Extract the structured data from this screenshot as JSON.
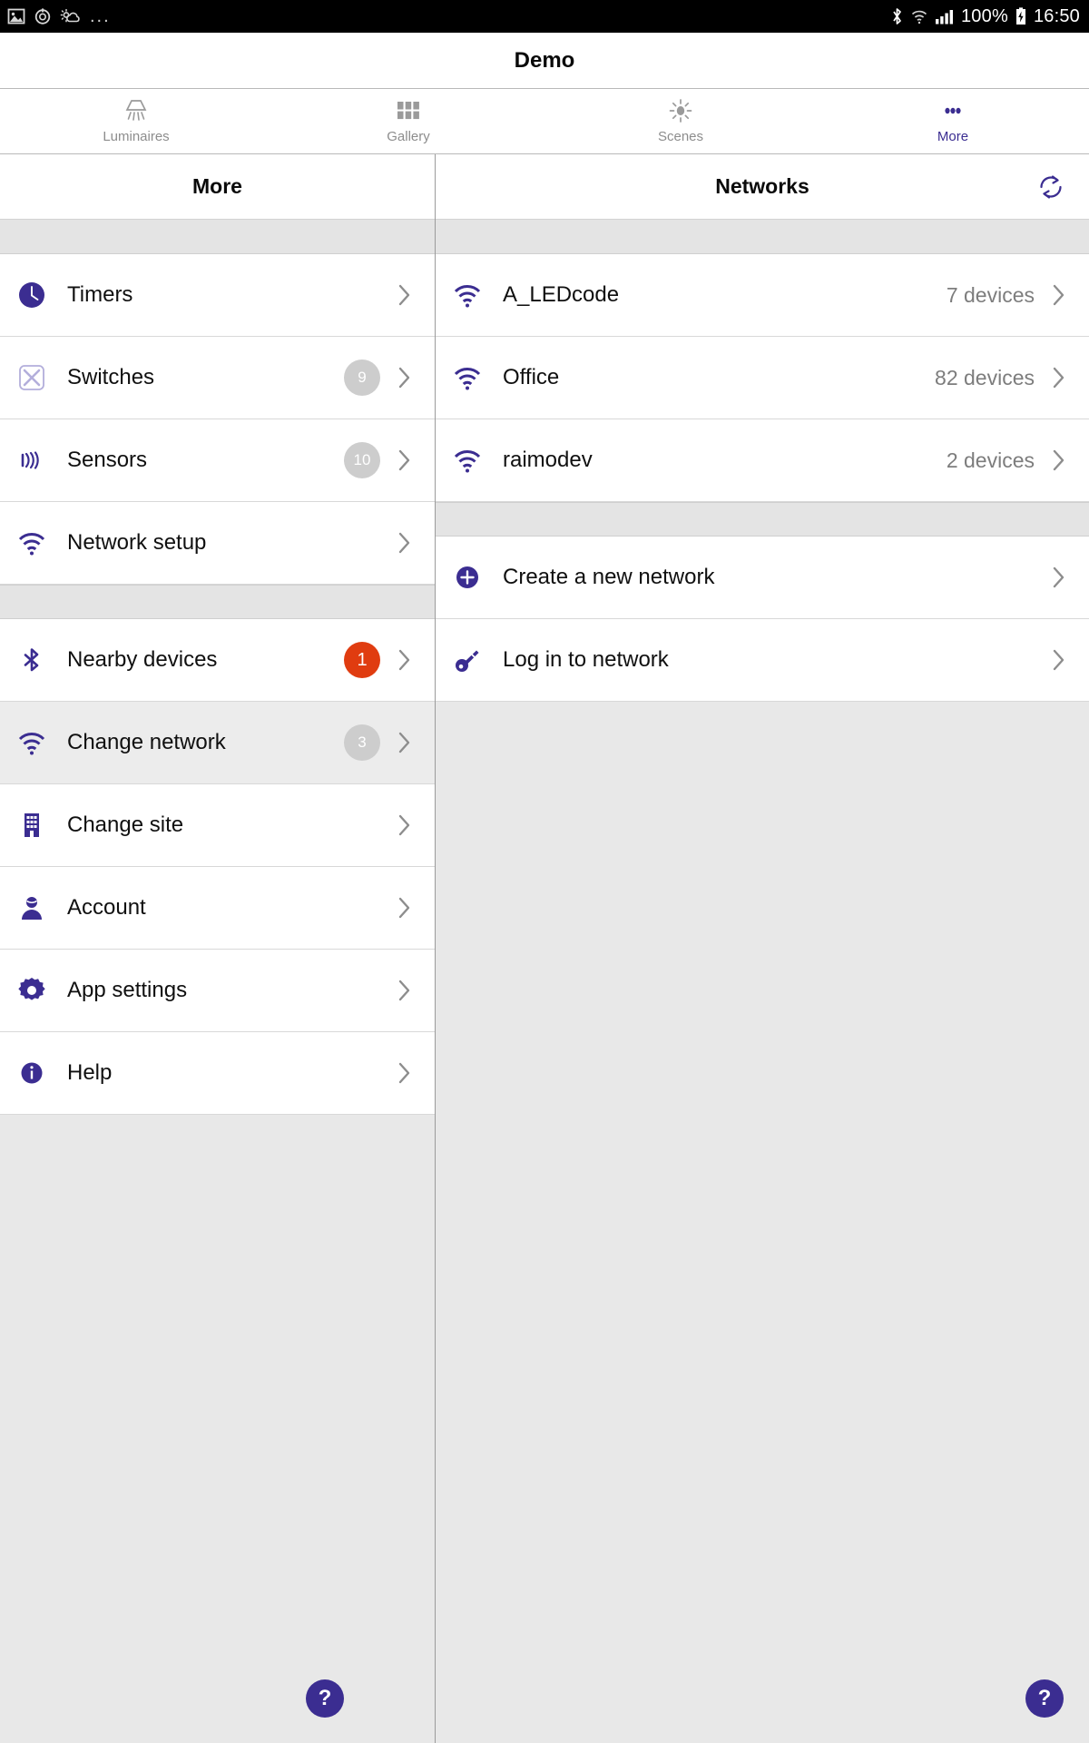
{
  "status_bar": {
    "left_icons": [
      "image-icon",
      "alarm-icon",
      "weather-icon"
    ],
    "overflow": "...",
    "bluetooth_icon": "bluetooth-icon",
    "wifi_icon": "wifi-icon",
    "signal_icon": "signal-bars-icon",
    "battery_percent": "100%",
    "battery_icon": "battery-charging-icon",
    "time": "16:50"
  },
  "app": {
    "title": "Demo",
    "accent_color": "#3b2d91",
    "alert_color": "#e03c10"
  },
  "tabs": [
    {
      "label": "Luminaires",
      "icon": "luminaire-lamp-icon",
      "active": false
    },
    {
      "label": "Gallery",
      "icon": "grid-icon",
      "active": false
    },
    {
      "label": "Scenes",
      "icon": "sun-brightness-icon",
      "active": false
    },
    {
      "label": "More",
      "icon": "more-dots-icon",
      "active": true
    }
  ],
  "left_pane": {
    "title": "More",
    "groups": [
      {
        "items": [
          {
            "label": "Timers",
            "icon": "clock-icon",
            "badge": null,
            "selected": false
          },
          {
            "label": "Switches",
            "icon": "switch-x-icon",
            "badge": "9",
            "selected": false
          },
          {
            "label": "Sensors",
            "icon": "sensor-waves-icon",
            "badge": "10",
            "selected": false
          },
          {
            "label": "Network setup",
            "icon": "wifi-icon",
            "badge": null,
            "selected": false
          }
        ]
      },
      {
        "items": [
          {
            "label": "Nearby devices",
            "icon": "bluetooth-icon",
            "badge": "1",
            "badge_style": "alert",
            "selected": false
          },
          {
            "label": "Change network",
            "icon": "wifi-icon",
            "badge": "3",
            "selected": true
          },
          {
            "label": "Change site",
            "icon": "building-icon",
            "badge": null,
            "selected": false
          },
          {
            "label": "Account",
            "icon": "person-icon",
            "badge": null,
            "selected": false
          },
          {
            "label": "App settings",
            "icon": "gear-icon",
            "badge": null,
            "selected": false
          },
          {
            "label": "Help",
            "icon": "info-circle-icon",
            "badge": null,
            "selected": false
          }
        ]
      }
    ],
    "help_button": "?"
  },
  "right_pane": {
    "title": "Networks",
    "refresh_icon": "sync-refresh-icon",
    "networks": [
      {
        "name": "A_LEDcode",
        "icon": "wifi-icon",
        "devices": "7 devices"
      },
      {
        "name": "Office",
        "icon": "wifi-icon",
        "devices": "82 devices"
      },
      {
        "name": "raimodev",
        "icon": "wifi-icon",
        "devices": "2 devices"
      }
    ],
    "actions": [
      {
        "label": "Create a new network",
        "icon": "plus-circle-icon"
      },
      {
        "label": "Log in to network",
        "icon": "key-icon"
      }
    ],
    "help_button": "?"
  }
}
